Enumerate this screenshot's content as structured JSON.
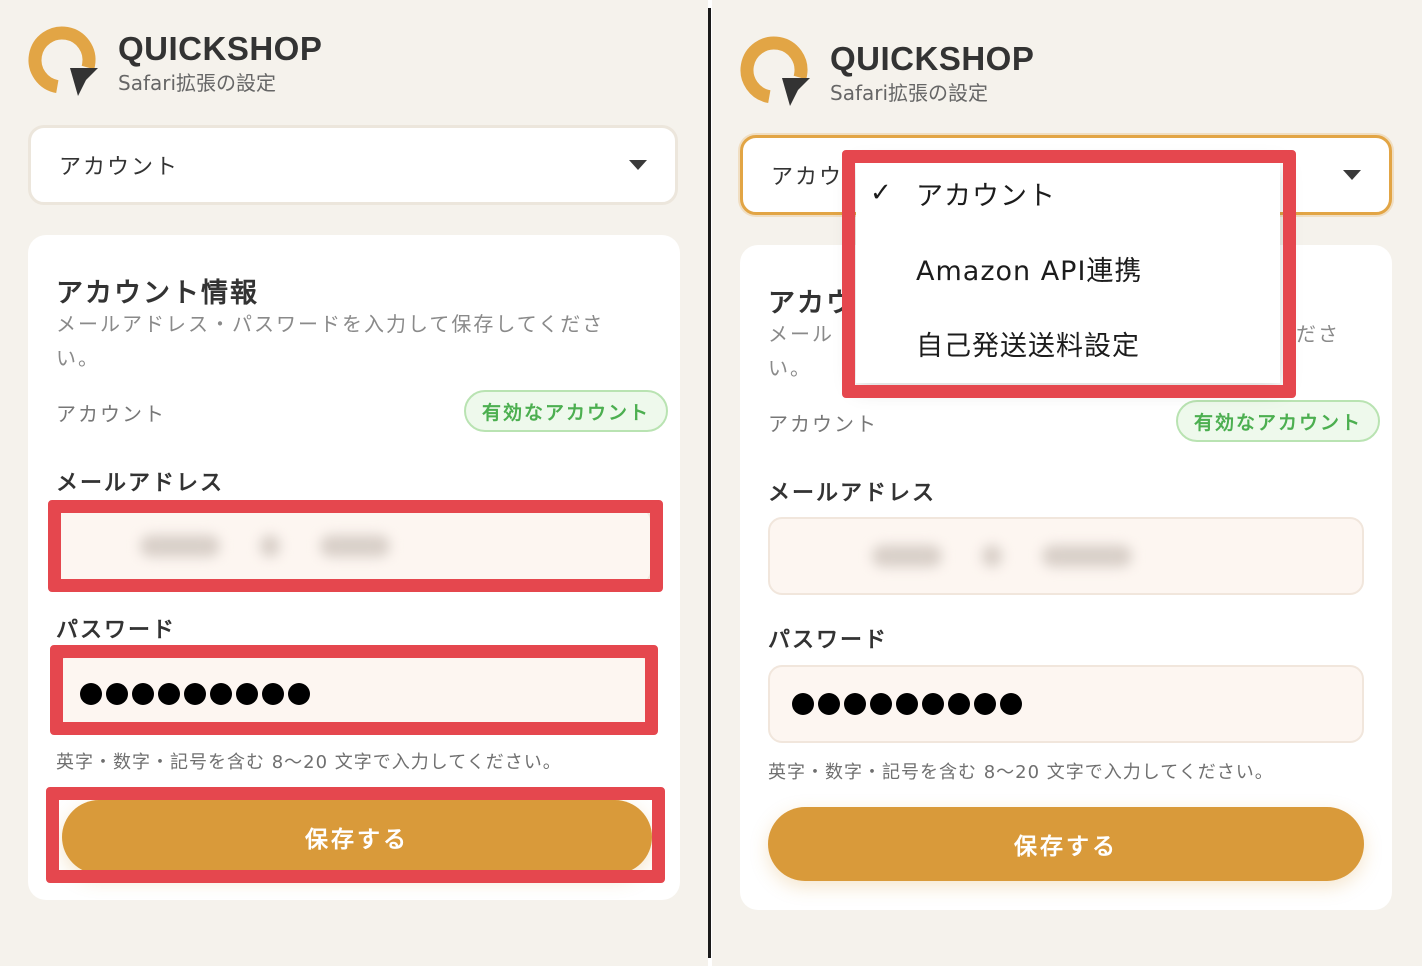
{
  "app": {
    "brand_title": "QUICKSHOP",
    "brand_subtitle": "Safari拡張の設定",
    "accent_color": "#d99a3a",
    "highlight_color": "#e5474e"
  },
  "left": {
    "select": {
      "value": "アカウント"
    },
    "card": {
      "title": "アカウント情報",
      "desc_line1": "メールアドレス・パスワードを入力して保存してくださ",
      "desc_line2": "い。",
      "account_label": "アカウント",
      "status_badge": "有効なアカウント",
      "email_label": "メールアドレス",
      "email_value": "(blurred)",
      "password_label": "パスワード",
      "password_mask": "●●●●●●●●●",
      "hint": "英字・数字・記号を含む 8〜20 文字で入力してください。",
      "save_label": "保存する"
    }
  },
  "right": {
    "select": {
      "value_partial": "アカウ"
    },
    "dropdown": {
      "items": [
        {
          "label": "アカウント",
          "selected": true
        },
        {
          "label": "Amazon API連携",
          "selected": false
        },
        {
          "label": "自己発送送料設定",
          "selected": false
        }
      ],
      "check_mark": "✓"
    },
    "card": {
      "title_partial": "アカウ",
      "desc_line1_partial": "メール",
      "desc_line1_end": "ださ",
      "desc_line2": "い。",
      "account_label": "アカウント",
      "status_badge": "有効なアカウント",
      "email_label": "メールアドレス",
      "password_label": "パスワード",
      "password_mask": "●●●●●●●●●",
      "hint": "英字・数字・記号を含む 8〜20 文字で入力してください。",
      "save_label": "保存する"
    }
  }
}
